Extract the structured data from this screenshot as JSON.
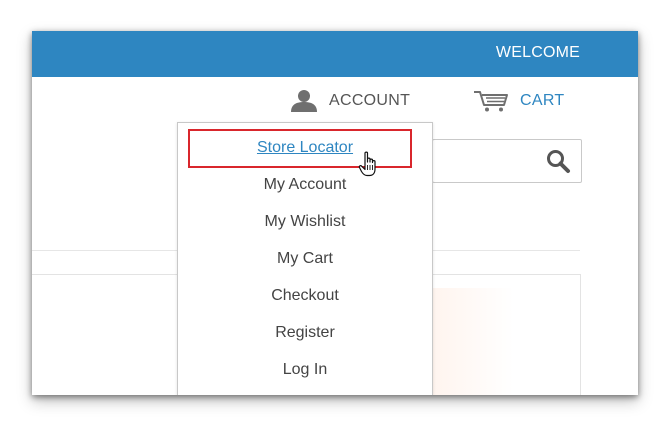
{
  "header": {
    "welcome_text": "WELCOME",
    "bar_color": "#2e86c1"
  },
  "nav": {
    "account_label": "ACCOUNT",
    "account_icon": "user-icon",
    "cart_label": "CART",
    "cart_icon": "shopping-cart-icon",
    "link_color": "#2e86c1"
  },
  "search": {
    "icon": "search-icon"
  },
  "account_menu": {
    "items": [
      {
        "label": "Store Locator",
        "state": "hover"
      },
      {
        "label": "My Account"
      },
      {
        "label": "My Wishlist"
      },
      {
        "label": "My Cart"
      },
      {
        "label": "Checkout"
      },
      {
        "label": "Register"
      },
      {
        "label": "Log In"
      }
    ],
    "highlight_color": "#d9262c"
  },
  "cursor": {
    "icon": "hand-pointer-icon"
  }
}
